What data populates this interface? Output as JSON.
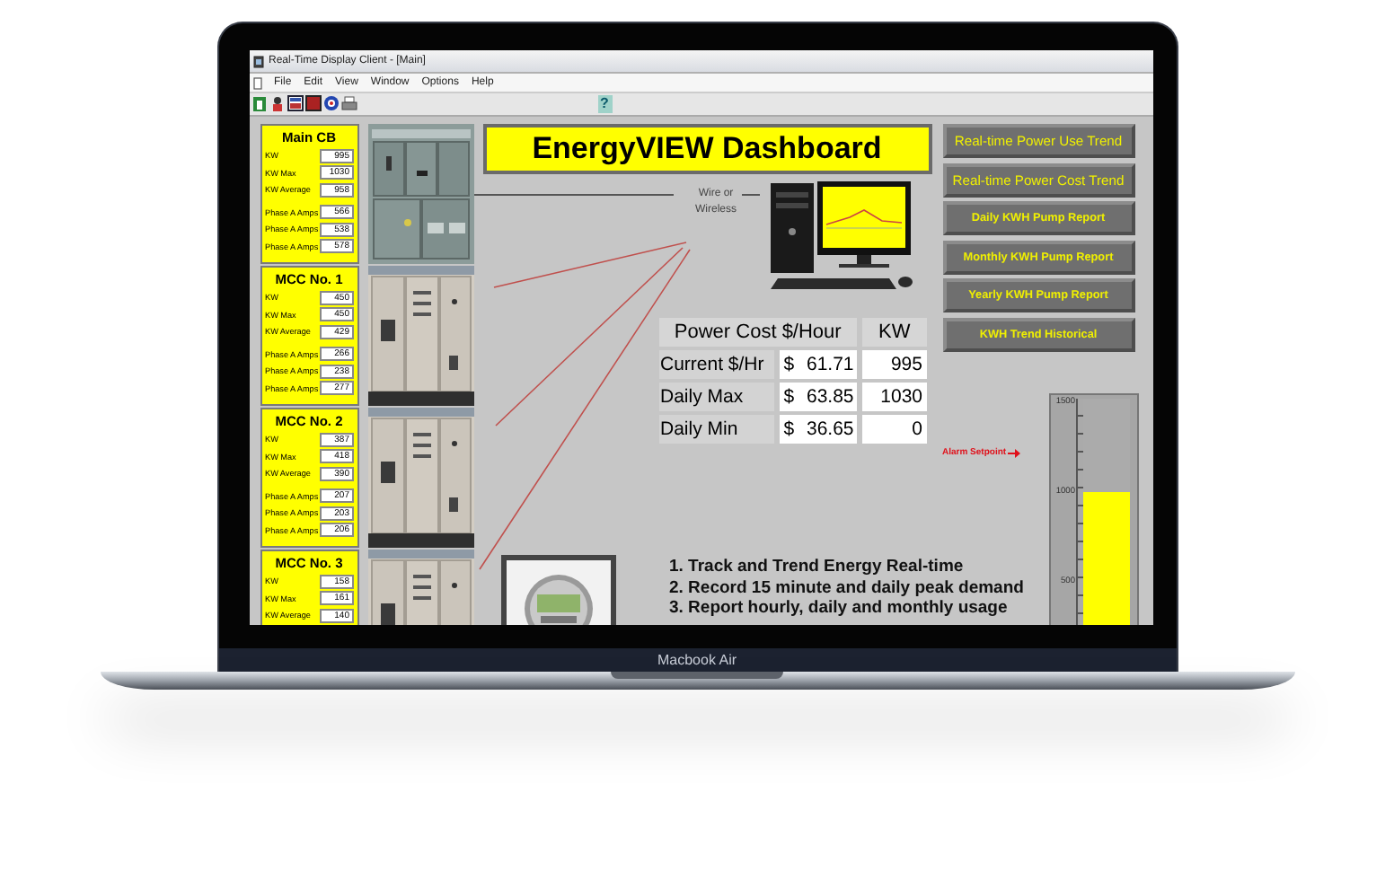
{
  "device": {
    "label": "Macbook Air"
  },
  "window": {
    "title": "Real-Time Display Client - [Main]"
  },
  "menu": [
    "File",
    "Edit",
    "View",
    "Window",
    "Options",
    "Help"
  ],
  "toolbar": {
    "help_button": "?"
  },
  "panels": [
    {
      "title": "Main CB",
      "kw_readings": [
        {
          "label": "KW",
          "value": "995"
        },
        {
          "label": "KW Max",
          "value": "1030"
        },
        {
          "label": "KW Average",
          "value": "958"
        }
      ],
      "amp_readings": [
        {
          "label": "Phase A Amps",
          "value": "566"
        },
        {
          "label": "Phase A Amps",
          "value": "538"
        },
        {
          "label": "Phase A Amps",
          "value": "578"
        }
      ]
    },
    {
      "title": "MCC No. 1",
      "kw_readings": [
        {
          "label": "KW",
          "value": "450"
        },
        {
          "label": "KW Max",
          "value": "450"
        },
        {
          "label": "KW Average",
          "value": "429"
        }
      ],
      "amp_readings": [
        {
          "label": "Phase A Amps",
          "value": "266"
        },
        {
          "label": "Phase A Amps",
          "value": "238"
        },
        {
          "label": "Phase A Amps",
          "value": "277"
        }
      ]
    },
    {
      "title": "MCC No. 2",
      "kw_readings": [
        {
          "label": "KW",
          "value": "387"
        },
        {
          "label": "KW Max",
          "value": "418"
        },
        {
          "label": "KW Average",
          "value": "390"
        }
      ],
      "amp_readings": [
        {
          "label": "Phase A Amps",
          "value": "207"
        },
        {
          "label": "Phase A Amps",
          "value": "203"
        },
        {
          "label": "Phase A Amps",
          "value": "206"
        }
      ]
    },
    {
      "title": "MCC No. 3",
      "kw_readings": [
        {
          "label": "KW",
          "value": "158"
        },
        {
          "label": "KW Max",
          "value": "161"
        },
        {
          "label": "KW Average",
          "value": "140"
        }
      ]
    }
  ],
  "dashboard": {
    "title": "EnergyVIEW Dashboard",
    "link_label": "Wire or Wireless"
  },
  "cost_table": {
    "columns": [
      "Power Cost $/Hour",
      "KW"
    ],
    "rows": [
      {
        "label": "Current $/Hr",
        "currency": "$",
        "cost": "61.71",
        "kw": "995"
      },
      {
        "label": "Daily Max",
        "currency": "$",
        "cost": "63.85",
        "kw": "1030"
      },
      {
        "label": "Daily Min",
        "currency": "$",
        "cost": "36.65",
        "kw": "0"
      }
    ]
  },
  "buttons": [
    "Real-time Power Use Trend",
    "Real-time Power Cost Trend",
    "Daily KWH Pump Report",
    "Monthly KWH Pump Report",
    "Yearly KWH Pump Report",
    "KWH Trend Historical"
  ],
  "meter": {
    "ticks": [
      "1500",
      "1000",
      "500"
    ],
    "alarm_label": "Alarm Setpoint",
    "level": 0.667
  },
  "features": [
    "1. Track and Trend Energy Real-time",
    "2. Record 15 minute and daily peak demand",
    "3. Report hourly, daily and monthly usage"
  ]
}
